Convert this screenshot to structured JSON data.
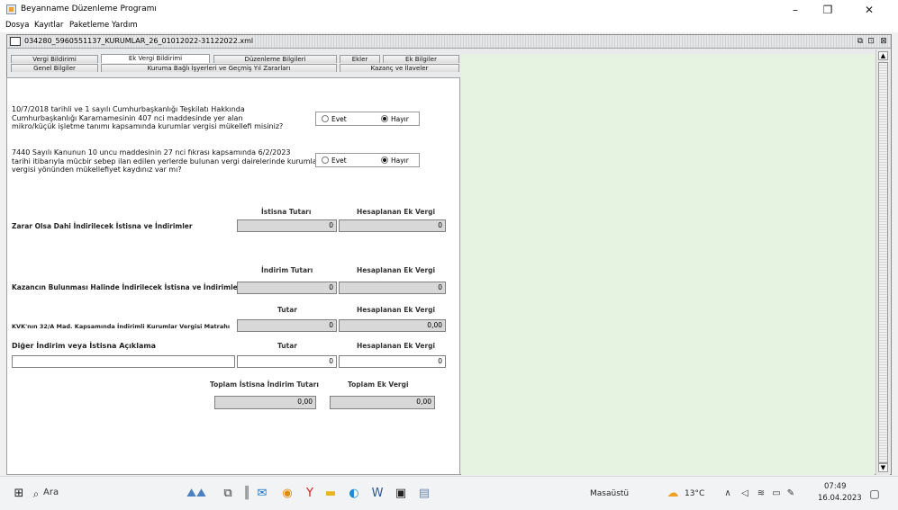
{
  "window": {
    "title": "Beyanname Düzenleme Programı",
    "controls": {
      "minimize": "–",
      "maximize": "❐",
      "close": "✕"
    }
  },
  "menu": [
    "Dosya",
    "Kayıtlar",
    "Paketleme",
    "Yardım"
  ],
  "document": {
    "file_name": "034280_5960551137_KURUMLAR_26_01012022-31122022.xml",
    "controls": {
      "restore": "⧉",
      "max": "⊡",
      "close": "⊠"
    }
  },
  "tabs_row1": [
    "Vergi Bildirimi",
    "Ek Vergi Bildirimi",
    "Düzenleme Bilgileri",
    "Ekler",
    "Ek Bilgiler"
  ],
  "tabs_row2": [
    "Genel Bilgiler",
    "Kuruma Bağlı İşyerleri ve Geçmiş Yıl Zararları",
    "Kazanç ve İlaveler"
  ],
  "questions": [
    {
      "lines": [
        "10/7/2018 tarihli ve 1 sayılı Cumhurbaşkanlığı Teşkilatı Hakkında",
        "Cumhurbaşkanlığı Kararnamesinin 407 nci maddesinde yer alan",
        "mikro/küçük işletme tanımı kapsamında kurumlar vergisi mükellefi misiniz?"
      ],
      "option_yes": "Evet",
      "option_no": "Hayır",
      "selected": "Hayır"
    },
    {
      "lines": [
        "7440 Sayılı Kanunun 10 uncu maddesinin 27 nci fıkrası kapsamında 6/2/2023",
        "tarihi itibarıyla mücbir sebep ilan edilen yerlerde bulunan vergi dairelerinde kurumlar",
        "vergisi yönünden mükellefiyet kaydınız var mı?"
      ],
      "option_yes": "Evet",
      "option_no": "Hayır",
      "selected": "Hayır"
    }
  ],
  "section1": {
    "h1": "İstisna Tutarı",
    "h2": "Hesaplanan Ek Vergi",
    "label": "Zarar Olsa Dahi İndirilecek İstisna ve İndirimler",
    "v1": "0",
    "v2": "0"
  },
  "section2": {
    "h1": "İndirim Tutarı",
    "h2": "Hesaplanan Ek Vergi",
    "label": "Kazancın Bulunması Halinde İndirilecek İstisna ve İndirimler",
    "v1": "0",
    "v2": "0"
  },
  "section3": {
    "h1": "Tutar",
    "h2": "Hesaplanan Ek Vergi",
    "label": "KVK'nın 32/A Mad. Kapsamında İndirimli Kurumlar Vergisi Matrahı",
    "v1": "0",
    "v2": "0,00"
  },
  "section4": {
    "label": "Diğer İndirim veya İstisna Açıklama",
    "h1": "Tutar",
    "h2": "Hesaplanan Ek Vergi",
    "desc": "",
    "v1": "0",
    "v2": "0"
  },
  "totals": {
    "h1": "Toplam İstisna İndirim Tutarı",
    "h2": "Toplam Ek Vergi",
    "v1": "0,00",
    "v2": "0,00"
  },
  "taskbar": {
    "search_placeholder": "Ara",
    "desktop_label": "Masaüstü",
    "temperature": "13°C",
    "time": "07:49",
    "date": "16.04.2023"
  }
}
